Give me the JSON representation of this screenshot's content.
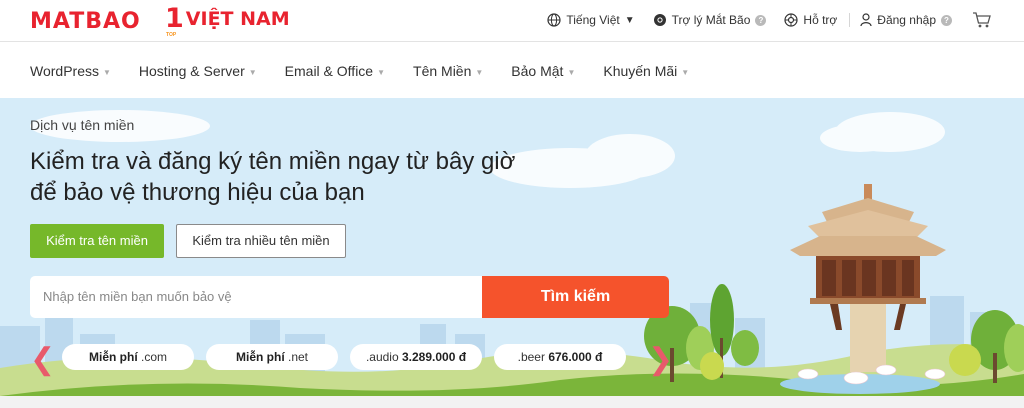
{
  "brand": {
    "logo_text": "MATBAO",
    "promo_number": "1",
    "promo_text": "VIỆT NAM",
    "promo_sub": "TOP"
  },
  "topbar": {
    "language": "Tiếng Việt",
    "assistant": "Trợ lý Mắt Bão",
    "support": "Hỗ trợ",
    "login": "Đăng nhập",
    "help_mark": "?",
    "icons": [
      "globe-icon",
      "chrome-icon",
      "support-icon",
      "user-icon",
      "cart-icon"
    ]
  },
  "nav": {
    "items": [
      {
        "label": "WordPress"
      },
      {
        "label": "Hosting & Server"
      },
      {
        "label": "Email & Office"
      },
      {
        "label": "Tên Miền"
      },
      {
        "label": "Bảo Mật"
      },
      {
        "label": "Khuyến Mãi"
      }
    ]
  },
  "hero": {
    "eyebrow": "Dịch vụ tên miền",
    "headline_line1": "Kiểm tra và đăng ký tên miền ngay từ bây giờ",
    "headline_line2": "để bảo vệ thương hiệu của bạn",
    "btn_single": "Kiểm tra tên miền",
    "btn_multi": "Kiểm tra nhiều tên miền",
    "search_placeholder": "Nhập tên miền bạn muốn bảo vệ",
    "search_button": "Tìm kiếm"
  },
  "promos": [
    {
      "bold": "Miễn phí",
      "text": " .com"
    },
    {
      "bold": "Miễn phí",
      "text": " .net"
    },
    {
      "text": ".audio ",
      "bold": "3.289.000 đ"
    },
    {
      "text": ".beer ",
      "bold": "676.000 đ"
    }
  ],
  "colors": {
    "brand_red": "#e8232f",
    "green_button": "#76b82a",
    "search_button": "#f5532c",
    "hero_sky": "#d6ecf9"
  }
}
